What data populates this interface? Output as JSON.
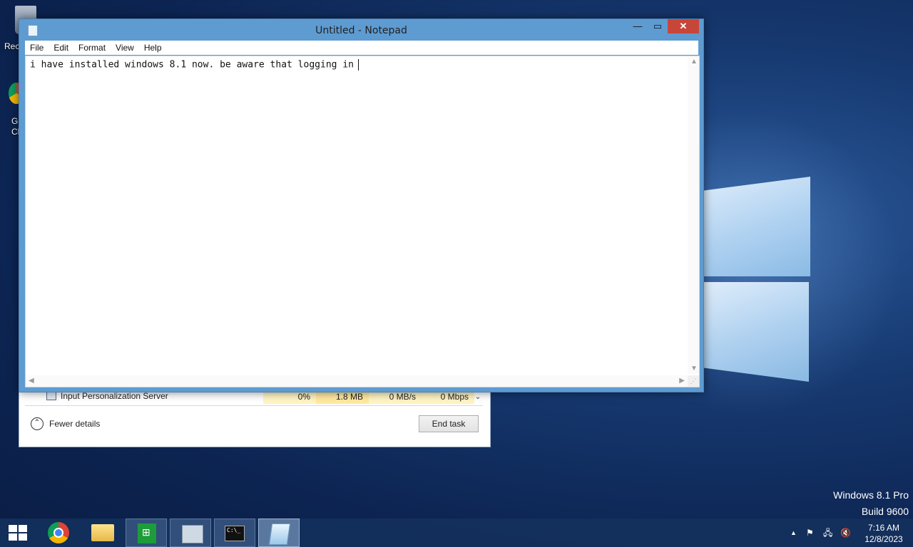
{
  "desktop": {
    "recycle_label": "Rec",
    "chrome_label_1": "G",
    "chrome_label_2": "Cl",
    "watermark": {
      "line1": "Windows 8.1 Pro",
      "line2": "Build 9600"
    }
  },
  "task_manager": {
    "row": {
      "name": "Input Personalization Server",
      "cpu": "0%",
      "memory": "1.8 MB",
      "disk": "0 MB/s",
      "network": "0 Mbps"
    },
    "fewer_details": "Fewer details",
    "end_task": "End task"
  },
  "notepad": {
    "title": "Untitled - Notepad",
    "menu": [
      "File",
      "Edit",
      "Format",
      "View",
      "Help"
    ],
    "text": "i have installed windows 8.1 now. be aware that logging in"
  },
  "taskbar": {
    "icons": [
      "start-icon",
      "chrome-icon",
      "file-explorer-icon",
      "store-icon",
      "performance-monitor-icon",
      "command-prompt-icon",
      "notepad-icon"
    ],
    "cmd_glyph": "C:\\_",
    "tray": {
      "expand": "▲",
      "flag": "⚑",
      "network": "🖧",
      "volume": "🔇"
    },
    "time": "7:16 AM",
    "date": "12/8/2023"
  }
}
